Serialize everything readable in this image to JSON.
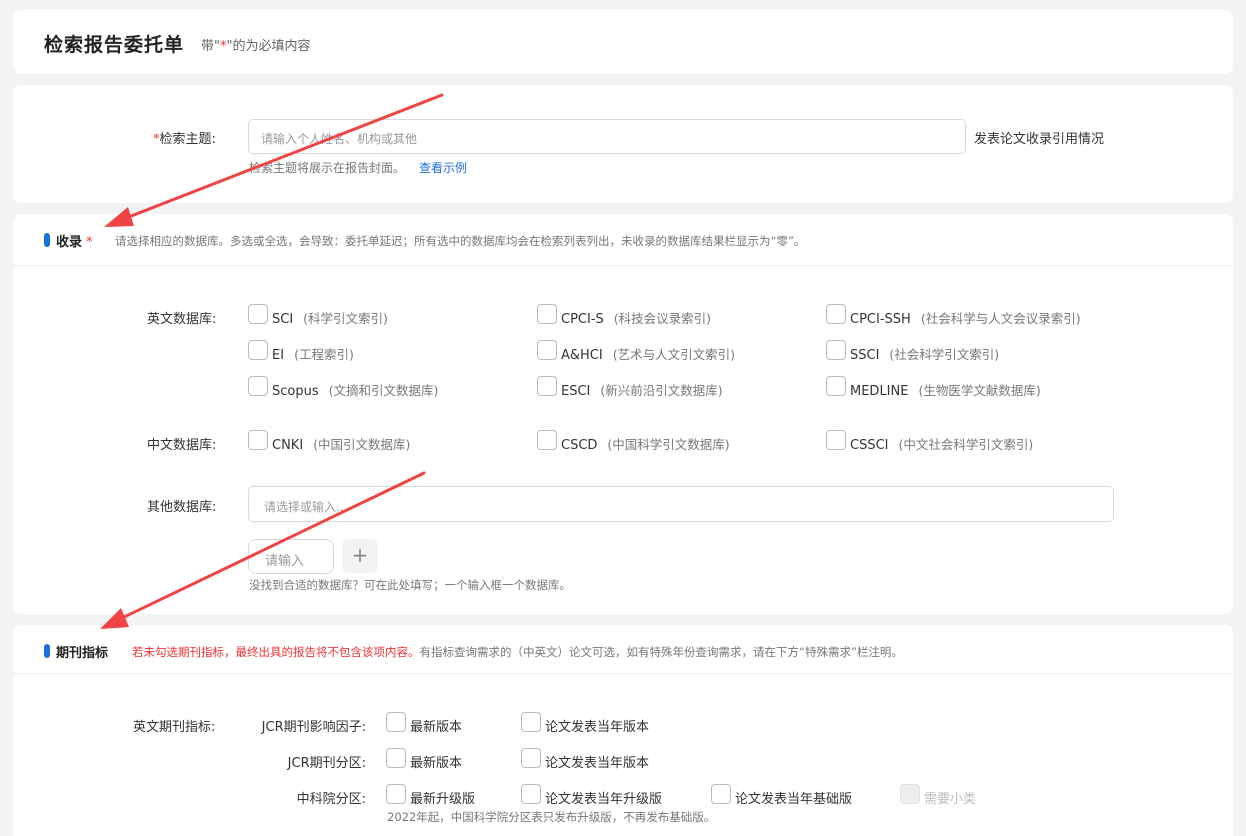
{
  "header": {
    "title": "检索报告委托单",
    "note_prefix": "带\"",
    "note_star": "*",
    "note_suffix": "\"的为必填内容"
  },
  "topic": {
    "required_mark": "*",
    "label": "检索主题:",
    "placeholder": "请输入个人姓名、机构或其他",
    "suffix": "发表论文收录引用情况",
    "hint": "检索主题将展示在报告封面。",
    "example_link": "查看示例"
  },
  "inclusion": {
    "title": "收录",
    "required_mark": "*",
    "description": "请选择相应的数据库。多选或全选，会导致：委托单延迟；所有选中的数据库均会在检索列表列出，未收录的数据库结果栏显示为“零”。",
    "english_label": "英文数据库:",
    "english_dbs": [
      {
        "name": "SCI",
        "note": "(科学引文索引)"
      },
      {
        "name": "CPCI-S",
        "note": "(科技会议录索引)"
      },
      {
        "name": "CPCI-SSH",
        "note": "(社会科学与人文会议录索引)"
      },
      {
        "name": "EI",
        "note": "(工程索引)"
      },
      {
        "name": "A&HCI",
        "note": "(艺术与人文引文索引)"
      },
      {
        "name": "SSCI",
        "note": "(社会科学引文索引)"
      },
      {
        "name": "Scopus",
        "note": "(文摘和引文数据库)"
      },
      {
        "name": "ESCI",
        "note": "(新兴前沿引文数据库)"
      },
      {
        "name": "MEDLINE",
        "note": "(生物医学文献数据库)"
      }
    ],
    "chinese_label": "中文数据库:",
    "chinese_dbs": [
      {
        "name": "CNKI",
        "note": "(中国引文数据库)"
      },
      {
        "name": "CSCD",
        "note": "(中国科学引文数据库)"
      },
      {
        "name": "CSSCI",
        "note": "(中文社会科学引文索引)"
      }
    ],
    "other_label": "其他数据库:",
    "other_placeholder": "请选择或输入...",
    "custom_placeholder": "请输入",
    "add_symbol": "+",
    "custom_hint": "没找到合适的数据库？可在此处填写；一个输入框一个数据库。"
  },
  "journal": {
    "title": "期刊指标",
    "warning": "若未勾选期刊指标，最终出具的报告将不包含该项内容。",
    "description": "有指标查询需求的（中英文）论文可选，如有特殊年份查询需求，请在下方“特殊需求”栏注明。",
    "english_label": "英文期刊指标:",
    "rows": [
      {
        "label": "JCR期刊影响因子:",
        "options": [
          "最新版本",
          "论文发表当年版本"
        ]
      },
      {
        "label": "JCR期刊分区:",
        "options": [
          "最新版本",
          "论文发表当年版本"
        ]
      },
      {
        "label": "中科院分区:",
        "options": [
          "最新升级版",
          "论文发表当年升级版",
          "论文发表当年基础版"
        ],
        "extra": "需要小类"
      }
    ],
    "cas_hint": "2022年起，中国科学院分区表只发布升级版，不再发布基础版。"
  },
  "colors": {
    "accent": "#1e6fe0",
    "required": "#ee3333",
    "arrow": "#ef4444"
  }
}
